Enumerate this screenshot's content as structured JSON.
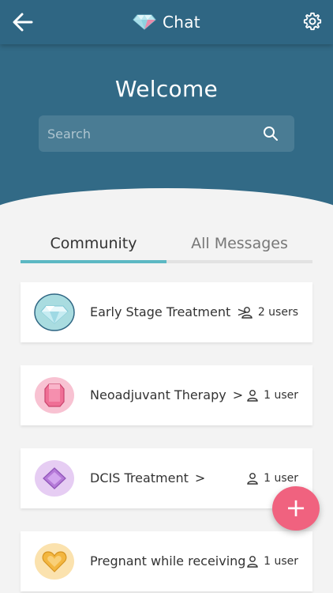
{
  "header": {
    "title": "Chat",
    "back_icon": "arrow-left-icon",
    "logo_icon": "diamond-icon",
    "settings_icon": "gear-icon"
  },
  "hero": {
    "welcome": "Welcome",
    "search_placeholder": "Search",
    "search_value": ""
  },
  "tabs": [
    {
      "label": "Community",
      "active": true
    },
    {
      "label": "All Messages",
      "active": false
    }
  ],
  "communities": [
    {
      "name": "Early Stage Treatment",
      "chevron": ">",
      "users": "2 users",
      "icon": "diamond-gem-icon",
      "icon_bg": "#a9dce0"
    },
    {
      "name": "Neoadjuvant Therapy",
      "chevron": ">",
      "users": "1 user",
      "icon": "ruby-gem-icon",
      "icon_bg": "#f8c2d2"
    },
    {
      "name": "DCIS Treatment",
      "chevron": ">",
      "users": "1 user",
      "icon": "amethyst-gem-icon",
      "icon_bg": "#e6cdf3"
    },
    {
      "name": "Pregnant while receiving",
      "chevron": "",
      "users": "1 user",
      "icon": "heart-gem-icon",
      "icon_bg": "#fbe2ae"
    }
  ],
  "fab": {
    "label": "+"
  },
  "colors": {
    "header_bg": "#2f6683",
    "accent_tab": "#5cb8c3",
    "fab_bg": "#f0627f"
  }
}
